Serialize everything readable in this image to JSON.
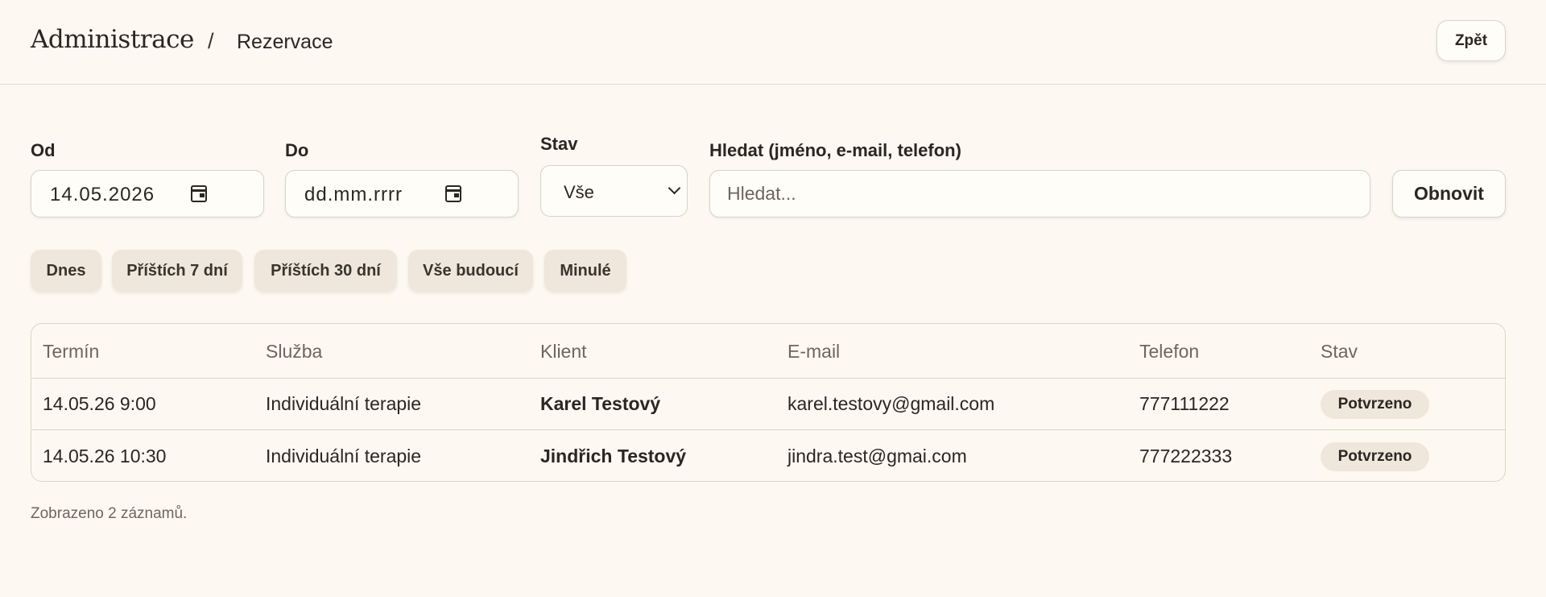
{
  "header": {
    "brand": "Administrace",
    "separator": "/",
    "page": "Rezervace",
    "back_label": "Zpět"
  },
  "filters": {
    "from_label": "Od",
    "from_value": "14.05.2026",
    "to_label": "Do",
    "to_value": "dd.mm.rrrr",
    "status_label": "Stav",
    "status_value": "Vše",
    "search_label": "Hledat (jméno, e-mail, telefon)",
    "search_placeholder": "Hledat...",
    "refresh_label": "Obnovit"
  },
  "quick_ranges": [
    "Dnes",
    "Příštích 7 dní",
    "Příštích 30 dní",
    "Vše budoucí",
    "Minulé"
  ],
  "table": {
    "columns": [
      "Termín",
      "Služba",
      "Klient",
      "E-mail",
      "Telefon",
      "Stav"
    ],
    "rows": [
      {
        "term": "14.05.26 9:00",
        "service": "Individuální terapie",
        "client": "Karel Testový",
        "email": "karel.testovy@gmail.com",
        "phone": "777111222",
        "status": "Potvrzeno"
      },
      {
        "term": "14.05.26 10:30",
        "service": "Individuální terapie",
        "client": "Jindřich Testový",
        "email": "jindra.test@gmai.com",
        "phone": "777222333",
        "status": "Potvrzeno"
      }
    ]
  },
  "footer": {
    "count_text": "Zobrazeno 2 záznamů."
  },
  "icons": {
    "date_picker": "calendar-icon",
    "select": "chevron-down-icon"
  }
}
